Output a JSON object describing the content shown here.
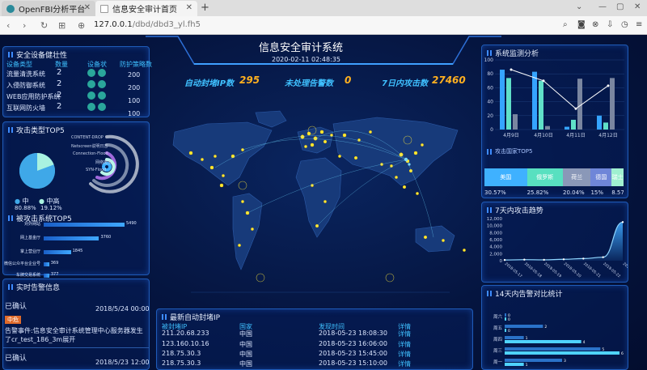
{
  "browser": {
    "tabs": [
      {
        "label": "OpenFBI分析平台"
      },
      {
        "label": "信息安全审计首页"
      }
    ],
    "url_host": "127.0.0.1",
    "url_path": "/dbd/dbd3_yl.fh5"
  },
  "header": {
    "title": "信息安全审计系统",
    "time": "2020-02-11 02:48:35"
  },
  "stats": [
    {
      "label": "自动封堵IP数",
      "value": "295"
    },
    {
      "label": "未处理告警数",
      "value": "0"
    },
    {
      "label": "7日内攻击数",
      "value": "27460"
    }
  ],
  "device_health": {
    "title": "安全设备健壮性",
    "headers": [
      "设备类型",
      "数量",
      "设备状",
      "防护策略数"
    ],
    "rows": [
      {
        "type": "流量清洗系统",
        "count": "2",
        "policy": "200"
      },
      {
        "type": "入侵防御系统",
        "count": "2",
        "policy": "200"
      },
      {
        "type": "WEB应用防护系统",
        "count": "2",
        "policy": "100"
      },
      {
        "type": "互联网防火墙",
        "count": "2",
        "policy": "100"
      }
    ]
  },
  "attack_types": {
    "title": "攻击类型TOP5",
    "ring_labels": [
      "CONTENT-DROP",
      "Netscreen说明日志",
      "Connection-Flood",
      "网络爬虫",
      "SYN-Flood"
    ],
    "legend": [
      {
        "name": "中",
        "pct": "80.88%"
      },
      {
        "name": "中高",
        "pct": "19.12%"
      }
    ]
  },
  "attacked_systems": {
    "title": "被攻击系统TOP5",
    "items": [
      {
        "name": "对外网站",
        "value": 5490
      },
      {
        "name": "网上基金厅",
        "value": 3760
      },
      {
        "name": "掌上营业厅",
        "value": 1845
      },
      {
        "name": "微信公众平台企业号",
        "value": 369
      },
      {
        "name": "车牌交易系统",
        "value": 377
      }
    ]
  },
  "alerts": {
    "title": "实时告警信息",
    "items": [
      {
        "status": "已确认",
        "time": "2018/5/24 00:00",
        "level": "中危",
        "text": "告警事件:信息安全审计系统管理中心服务器发生了cr_test_186_3m展开"
      },
      {
        "status": "已确认",
        "time": "2018/5/23 12:00"
      }
    ]
  },
  "blocked_ip": {
    "title": "最新自动封堵IP",
    "headers": [
      "被封堵IP",
      "国家",
      "发现时间",
      "详情"
    ],
    "rows": [
      {
        "ip": "211.20.68.233",
        "country": "中国",
        "time": "2018-05-23 18:08:30",
        "detail": "详情"
      },
      {
        "ip": "123.160.10.16",
        "country": "中国",
        "time": "2018-05-23 16:06:00",
        "detail": "详情"
      },
      {
        "ip": "218.75.30.3",
        "country": "中国",
        "time": "2018-05-23 15:45:00",
        "detail": "详情"
      },
      {
        "ip": "218.75.30.3",
        "country": "中国",
        "time": "2018-05-23 15:10:00",
        "detail": "详情"
      }
    ]
  },
  "system_monitor": {
    "title": "系统监测分析",
    "chart_data": {
      "type": "bar",
      "categories": [
        "4月9日",
        "4月10日",
        "4月11日",
        "4月12日"
      ],
      "series": [
        {
          "values": [
            86,
            83,
            4,
            20
          ]
        },
        {
          "values": [
            74,
            70,
            14,
            10
          ]
        },
        {
          "values": [
            22,
            5,
            73,
            74
          ]
        },
        {
          "values": [
            86,
            70,
            30,
            63
          ]
        }
      ],
      "ylim": [
        0,
        100
      ],
      "yticks": [
        "0",
        "20",
        "40",
        "60",
        "80",
        "100"
      ],
      "colors": [
        "#35a4ff",
        "#60e0c8",
        "#7a86a0",
        "#ffffff"
      ]
    }
  },
  "attack_countries": {
    "title": "攻击国家TOP5",
    "items": [
      {
        "name": "美国",
        "pct": "30.57%",
        "color": "#3fb1ff"
      },
      {
        "name": "俄罗斯",
        "pct": "25.82%",
        "color": "#58e0c0"
      },
      {
        "name": "荷兰",
        "pct": "20.04%",
        "color": "#8a98b8"
      },
      {
        "name": "德国",
        "pct": "15%",
        "color": "#6f86d8"
      },
      {
        "name": "瑞士",
        "pct": "8.57%",
        "color": "#9ff0d0"
      }
    ]
  },
  "trend7": {
    "title": "7天内攻击趋势",
    "chart_data": {
      "type": "area",
      "categories": [
        "2018-05-17",
        "2018-05-18",
        "2018-05-19",
        "2018-05-20",
        "2018-05-21",
        "2018-05-22",
        "2018-05-23"
      ],
      "values": [
        200,
        300,
        250,
        400,
        600,
        1000,
        11000
      ],
      "ylim": [
        0,
        12000
      ],
      "yticks": [
        "0",
        "2,000",
        "4,000",
        "6,000",
        "8,000",
        "10,000",
        "12,000"
      ]
    }
  },
  "alert14": {
    "title": "14天内告警对比统计",
    "categories": [
      "周六",
      "周五",
      "周四",
      "周三",
      "周一"
    ],
    "this_week": [
      0,
      0,
      4,
      6,
      1
    ],
    "last_week": [
      0,
      2,
      1,
      5,
      3
    ]
  }
}
